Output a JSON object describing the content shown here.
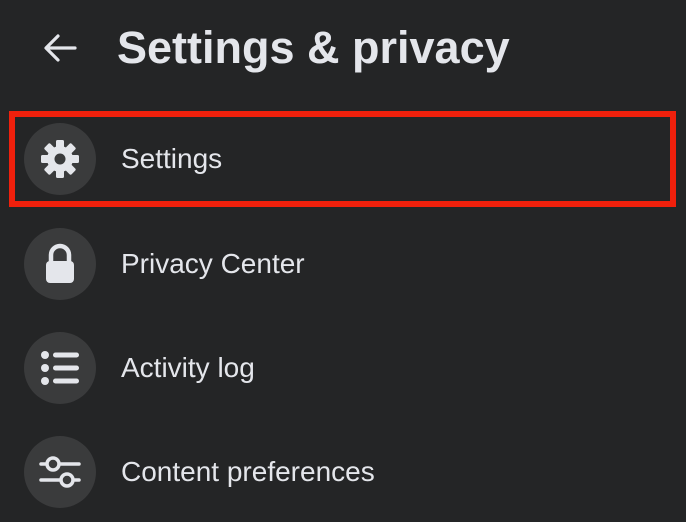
{
  "header": {
    "title": "Settings & privacy",
    "back_icon": "arrow-left-icon"
  },
  "menu": {
    "items": [
      {
        "label": "Settings",
        "icon": "gear-icon",
        "highlighted": true
      },
      {
        "label": "Privacy Center",
        "icon": "lock-icon",
        "highlighted": false
      },
      {
        "label": "Activity log",
        "icon": "list-icon",
        "highlighted": false
      },
      {
        "label": "Content preferences",
        "icon": "sliders-icon",
        "highlighted": false
      }
    ]
  },
  "colors": {
    "background": "#242526",
    "text": "#e4e6eb",
    "icon_circle": "#3a3b3c",
    "highlight": "#f0200c"
  }
}
